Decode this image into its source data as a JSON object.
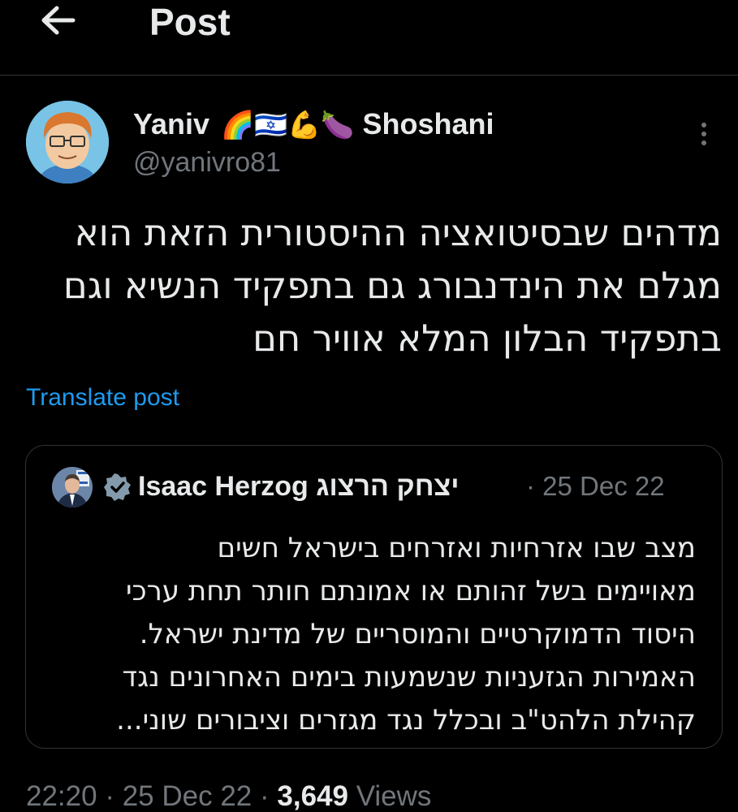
{
  "header": {
    "title": "Post",
    "back_icon": "arrow-left-icon"
  },
  "post": {
    "author_name": "Yaniv",
    "author_emojis": "🌈🇮🇱💪🍆",
    "author_surname": "Shoshani",
    "handle": "@yanivro81",
    "text_lines": [
      "מדהים שבסיטואציה ההיסטורית הזאת הוא",
      "מגלם את הינדנבורג גם בתפקיד הנשיא וגם",
      "בתפקיד הבלון המלא אוויר חם"
    ],
    "translate_label": "Translate post",
    "more_icon": "more-vertical-icon"
  },
  "quote": {
    "author_name": "Isaac Herzog יצחק הרצוג",
    "date": "· 25 Dec 22",
    "verified_icon": "verified-badge-icon",
    "text_lines": [
      "מצב שבו אזרחיות ואזרחים בישראל חשים",
      "מאויימים בשל זהותם או אמונתם חותר תחת ערכי",
      "היסוד הדמוקרטיים והמוסריים של מדינת ישראל.",
      "האמירות הגזעניות שנשמעות בימים האחרונים נגד",
      "קהילת הלהט\"ב ובכלל נגד מגזרים וציבורים שוני..."
    ]
  },
  "meta": {
    "time": "22:20",
    "sep1": " · ",
    "date": "25 Dec 22",
    "sep2": " · ",
    "views_count": "3,649",
    "views_label": " Views"
  },
  "colors": {
    "background": "#000000",
    "text": "#e7e9ea",
    "secondary": "#71767b",
    "link": "#1d9bf0",
    "border": "#2f3336"
  }
}
